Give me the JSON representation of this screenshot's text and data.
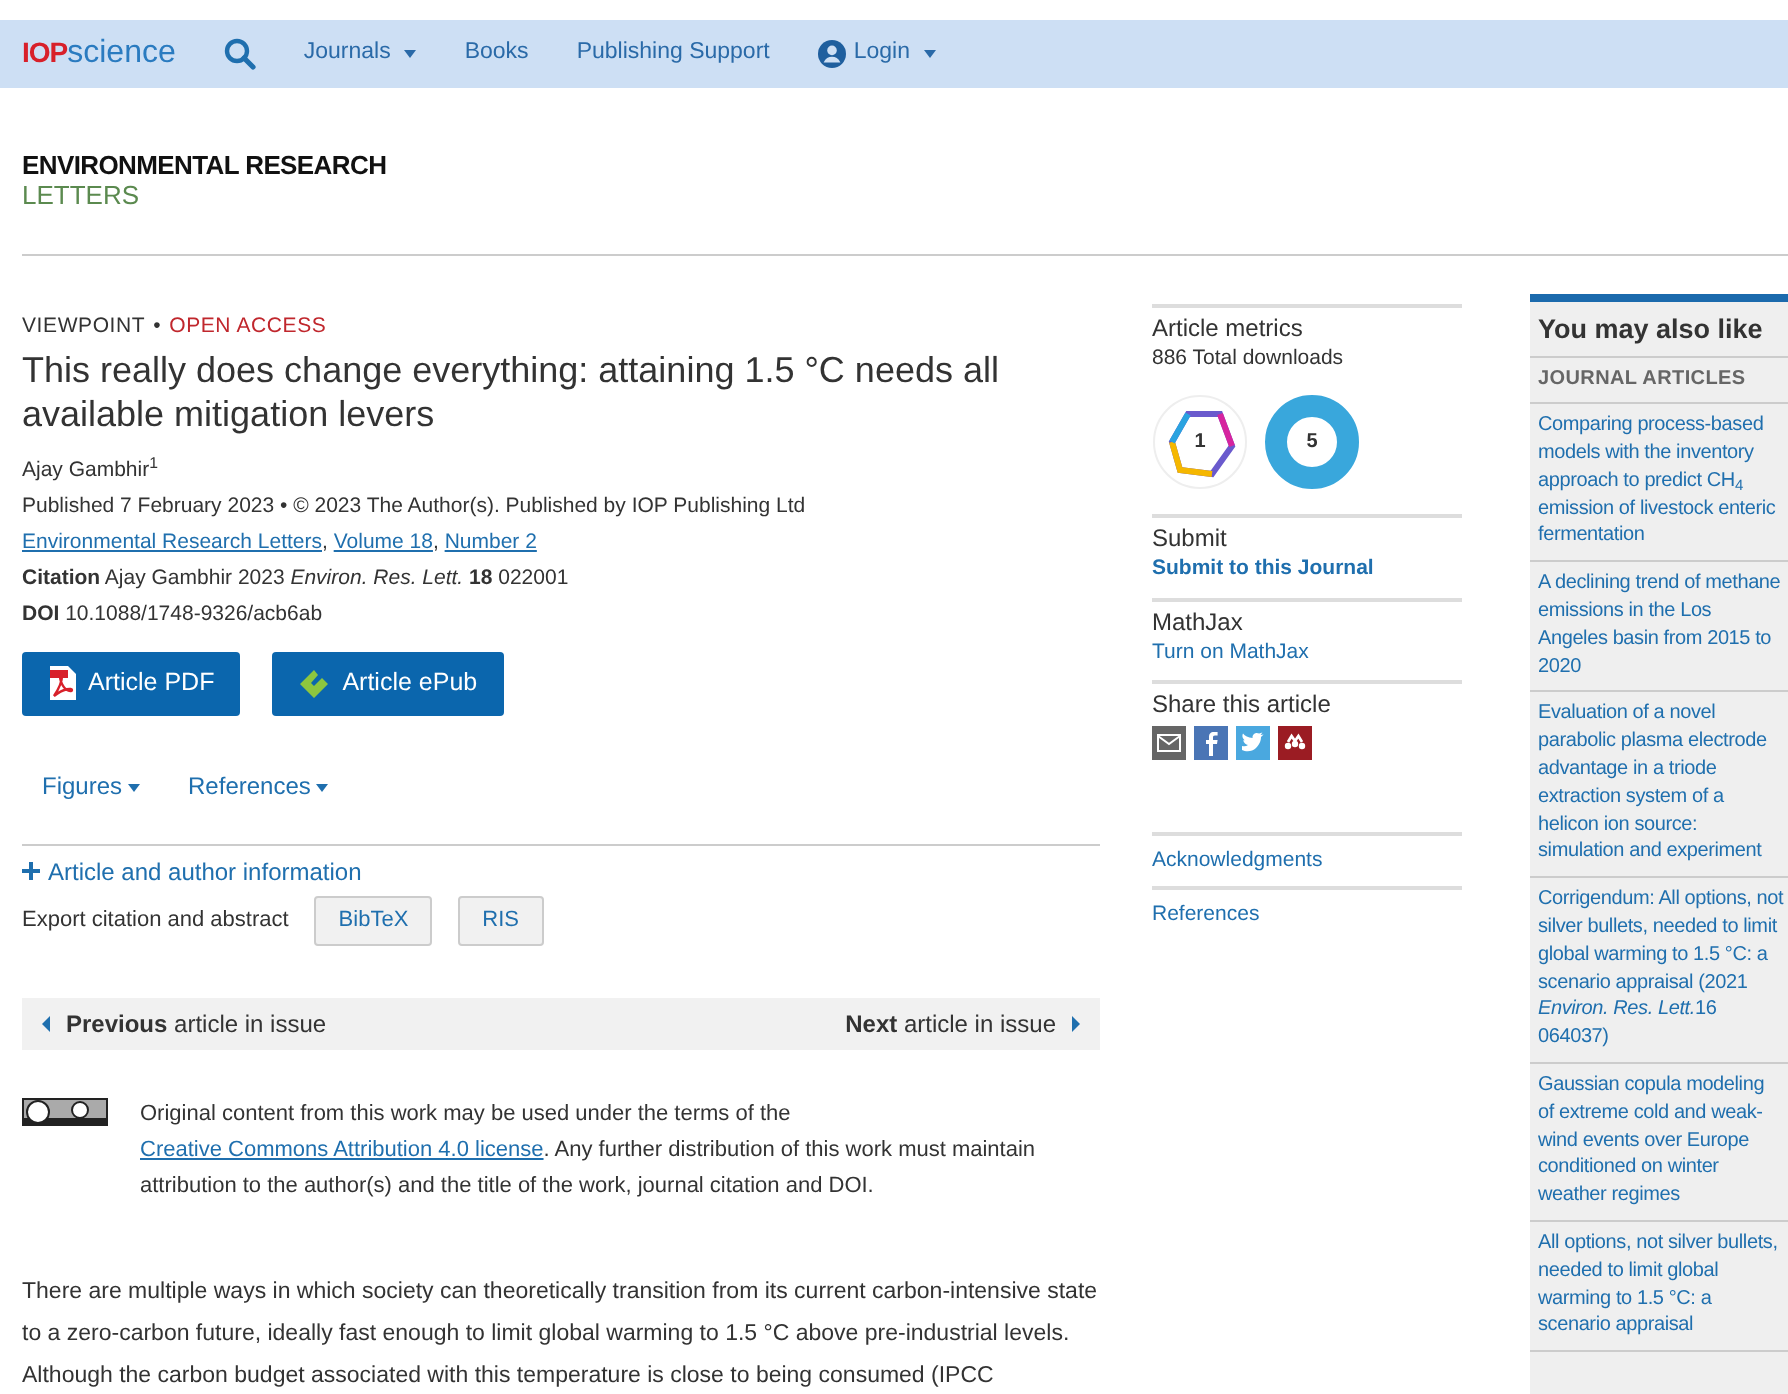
{
  "navbar": {
    "logo": [
      {
        "text": "IOP",
        "kind": "bold"
      },
      {
        "text": "science",
        "kind": "light"
      }
    ],
    "items": [
      {
        "label": "Journals",
        "kind": "link",
        "dropdown": true
      },
      {
        "label": "Books",
        "kind": "link",
        "dropdown": false
      },
      {
        "label": "Publishing Support",
        "kind": "link",
        "dropdown": false
      },
      {
        "label": "Login",
        "kind": "user",
        "dropdown": true
      }
    ]
  },
  "journal": {
    "line1": "ENVIRONMENTAL RESEARCH",
    "line2": "LETTERS"
  },
  "article": {
    "type": "VIEWPOINT",
    "type_separator": "•",
    "access": "OPEN ACCESS",
    "title": "This really does change everything: attaining 1.5 °C needs all available mitigation levers",
    "author": "Ajay Gambhir$^{1}$",
    "published": "Published 7 February 2023 • © 2023 The Author(s). Published by IOP Publishing Ltd",
    "source_links": [
      "Environmental Research Letters",
      "Volume 18",
      "Number 2"
    ],
    "link_separator": ",",
    "citation": "**Citation** Ajay Gambhir 2023 *Environ. Res. Lett.* **18** 022001",
    "doi": "**DOI** 10.1088/1748-9326/acb6ab",
    "buttons": [
      {
        "label": "Article PDF",
        "kind": "pdf"
      },
      {
        "label": "Article ePub",
        "kind": "epub"
      }
    ],
    "tabs": [
      {
        "label": "Figures",
        "dropdown": true
      },
      {
        "label": "References",
        "dropdown": true
      }
    ],
    "author_info": "Article and author information",
    "export": {
      "label": "Export citation and abstract",
      "buttons": [
        "BibTeX",
        "RIS"
      ]
    },
    "prev": "**Previous** article in issue",
    "next": "**Next** article in issue",
    "license": {
      "before": "Original content from this work may be used under the terms of the",
      "link": "Creative Commons Attribution 4.0 license",
      "after": ". Any further distribution of this work must maintain attribution to the author(s) and the title of the work, journal citation and DOI."
    },
    "body": "There are multiple ways in which society can theoretically transition from its current carbon-intensive state to a zero-carbon future, ideally fast enough to limit global warming to 1.5 °C above pre-industrial levels. Although the carbon budget associated with this temperature is close to being consumed (IPCC"
  },
  "side": {
    "metrics_title": "Article metrics",
    "downloads": "886 Total downloads",
    "badges": [
      {
        "kind": "dimensions",
        "value": "1"
      },
      {
        "kind": "altmetric",
        "value": "5"
      }
    ],
    "submit_title": "Submit",
    "submit_link": "Submit to this Journal",
    "mathjax_title": "MathJax",
    "mathjax_link": "Turn on MathJax",
    "share_title": "Share this article",
    "share": [
      {
        "kind": "email",
        "color": "#666666"
      },
      {
        "kind": "facebook",
        "color": "#4a75b5"
      },
      {
        "kind": "twitter",
        "color": "#4aa8df"
      },
      {
        "kind": "mendeley",
        "color": "#9b1c23"
      }
    ],
    "links": [
      "Acknowledgments",
      "References"
    ]
  },
  "related": {
    "title": "You may also like",
    "section": "JOURNAL ARTICLES",
    "items": [
      [
        {
          "text": "Comparing process-based models with the inventory approach to predict CH",
          "kind": "plain"
        },
        {
          "text": "4",
          "kind": "sub"
        },
        {
          "text": " emission of livestock enteric fermentation",
          "kind": "plain"
        }
      ],
      [
        {
          "text": "A declining trend of methane emissions in the Los Angeles basin from 2015 to 2020",
          "kind": "plain"
        }
      ],
      [
        {
          "text": "Evaluation of a novel parabolic plasma electrode advantage in a triode extraction system of a helicon ion source: simulation and experiment",
          "kind": "plain"
        }
      ],
      [
        {
          "text": "Corrigendum: All options, not silver bullets, needed to limit global warming to 1.5 °C: a scenario appraisal (2021 ",
          "kind": "plain"
        },
        {
          "text": "Environ. Res. Lett.",
          "kind": "italic"
        },
        {
          "text": "16 064037)",
          "kind": "plain"
        }
      ],
      [
        {
          "text": "Gaussian copula modeling of extreme cold and weak-wind events over Europe conditioned on winter weather regimes",
          "kind": "plain"
        }
      ],
      [
        {
          "text": "All options, not silver bullets, needed to limit global warming to 1.5 °C: a scenario appraisal",
          "kind": "plain"
        }
      ]
    ]
  }
}
